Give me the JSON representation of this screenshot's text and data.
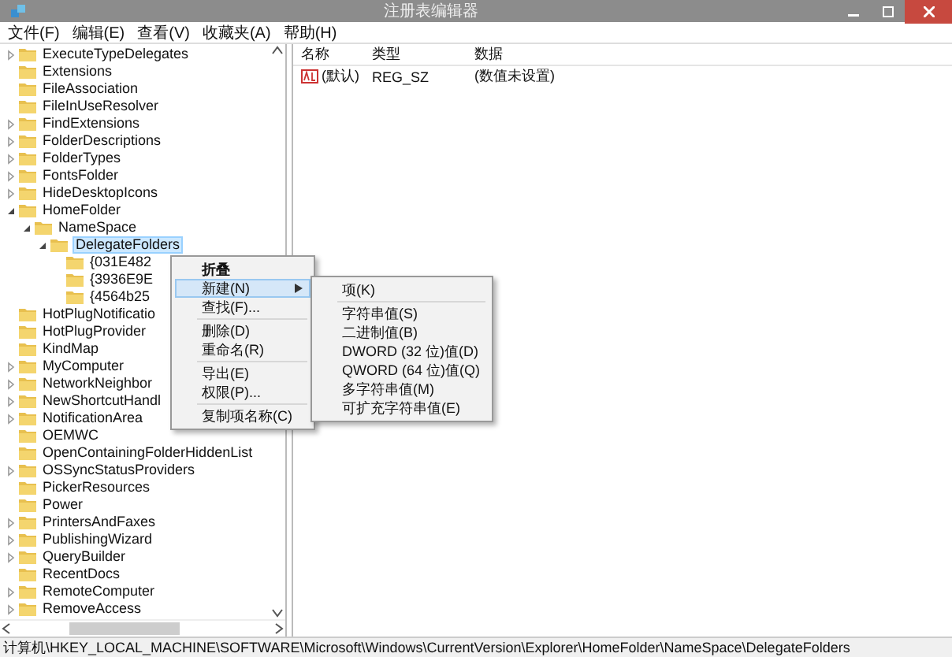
{
  "window": {
    "title": "注册表编辑器"
  },
  "menu_bar": [
    "文件(F)",
    "编辑(E)",
    "查看(V)",
    "收藏夹(A)",
    "帮助(H)"
  ],
  "tree": [
    {
      "label": "ExecuteTypeDelegates",
      "kind": "branch",
      "expanded": false,
      "selected": false
    },
    {
      "label": "Extensions",
      "kind": "leaf",
      "selected": false
    },
    {
      "label": "FileAssociation",
      "kind": "leaf",
      "selected": false
    },
    {
      "label": "FileInUseResolver",
      "kind": "leaf",
      "selected": false
    },
    {
      "label": "FindExtensions",
      "kind": "branch",
      "expanded": false,
      "selected": false
    },
    {
      "label": "FolderDescriptions",
      "kind": "branch",
      "expanded": false,
      "selected": false
    },
    {
      "label": "FolderTypes",
      "kind": "branch",
      "expanded": false,
      "selected": false
    },
    {
      "label": "FontsFolder",
      "kind": "branch",
      "expanded": false,
      "selected": false
    },
    {
      "label": "HideDesktopIcons",
      "kind": "branch",
      "expanded": false,
      "selected": false
    },
    {
      "label": "HomeFolder",
      "kind": "branch",
      "expanded": true,
      "selected": false,
      "children": [
        {
          "label": "NameSpace",
          "kind": "branch",
          "expanded": true,
          "selected": false,
          "children": [
            {
              "label": "DelegateFolders",
              "kind": "branch",
              "expanded": true,
              "selected": true,
              "children": [
                {
                  "label": "{031E482",
                  "kind": "leaf",
                  "selected": false
                },
                {
                  "label": "{3936E9E",
                  "kind": "leaf",
                  "selected": false
                },
                {
                  "label": "{4564b25",
                  "kind": "leaf",
                  "selected": false
                }
              ]
            }
          ]
        }
      ]
    },
    {
      "label": "HotPlugNotificatio",
      "kind": "leaf",
      "selected": false
    },
    {
      "label": "HotPlugProvider",
      "kind": "leaf",
      "selected": false
    },
    {
      "label": "KindMap",
      "kind": "leaf",
      "selected": false
    },
    {
      "label": "MyComputer",
      "kind": "branch",
      "expanded": false,
      "selected": false
    },
    {
      "label": "NetworkNeighbor",
      "kind": "branch",
      "expanded": false,
      "selected": false
    },
    {
      "label": "NewShortcutHandl",
      "kind": "branch",
      "expanded": false,
      "selected": false
    },
    {
      "label": "NotificationArea",
      "kind": "branch",
      "expanded": false,
      "selected": false
    },
    {
      "label": "OEMWC",
      "kind": "leaf",
      "selected": false
    },
    {
      "label": "OpenContainingFolderHiddenList",
      "kind": "leaf",
      "selected": false
    },
    {
      "label": "OSSyncStatusProviders",
      "kind": "branch",
      "expanded": false,
      "selected": false
    },
    {
      "label": "PickerResources",
      "kind": "leaf",
      "selected": false
    },
    {
      "label": "Power",
      "kind": "leaf",
      "selected": false
    },
    {
      "label": "PrintersAndFaxes",
      "kind": "branch",
      "expanded": false,
      "selected": false
    },
    {
      "label": "PublishingWizard",
      "kind": "branch",
      "expanded": false,
      "selected": false
    },
    {
      "label": "QueryBuilder",
      "kind": "branch",
      "expanded": false,
      "selected": false
    },
    {
      "label": "RecentDocs",
      "kind": "leaf",
      "selected": false
    },
    {
      "label": "RemoteComputer",
      "kind": "branch",
      "expanded": false,
      "selected": false
    },
    {
      "label": "RemoveAccess",
      "kind": "branch",
      "expanded": false,
      "selected": false
    }
  ],
  "values": {
    "columns": [
      "名称",
      "类型",
      "数据"
    ],
    "rows": [
      {
        "name": "(默认)",
        "type": "REG_SZ",
        "data": "(数值未设置)"
      }
    ]
  },
  "context_menu": [
    {
      "label": "折叠",
      "kind": "default",
      "selected": false
    },
    {
      "label": "新建(N)",
      "kind": "submenu",
      "selected": true
    },
    {
      "label": "查找(F)...",
      "kind": "item",
      "selected": false
    },
    {
      "kind": "separator"
    },
    {
      "label": "删除(D)",
      "kind": "item",
      "selected": false
    },
    {
      "label": "重命名(R)",
      "kind": "item",
      "selected": false
    },
    {
      "kind": "separator"
    },
    {
      "label": "导出(E)",
      "kind": "item",
      "selected": false
    },
    {
      "label": "权限(P)...",
      "kind": "item",
      "selected": false
    },
    {
      "kind": "separator"
    },
    {
      "label": "复制项名称(C)",
      "kind": "item",
      "selected": false
    }
  ],
  "submenu": [
    {
      "label": "项(K)",
      "kind": "item",
      "selected": false
    },
    {
      "kind": "separator"
    },
    {
      "label": "字符串值(S)",
      "kind": "item",
      "selected": false
    },
    {
      "label": "二进制值(B)",
      "kind": "item",
      "selected": false
    },
    {
      "label": "DWORD (32 位)值(D)",
      "kind": "item",
      "selected": false
    },
    {
      "label": "QWORD (64 位)值(Q)",
      "kind": "item",
      "selected": false
    },
    {
      "label": "多字符串值(M)",
      "kind": "item",
      "selected": false
    },
    {
      "label": "可扩充字符串值(E)",
      "kind": "item",
      "selected": false
    }
  ],
  "status_bar": "计算机\\HKEY_LOCAL_MACHINE\\SOFTWARE\\Microsoft\\Windows\\CurrentVersion\\Explorer\\HomeFolder\\NameSpace\\DelegateFolders"
}
